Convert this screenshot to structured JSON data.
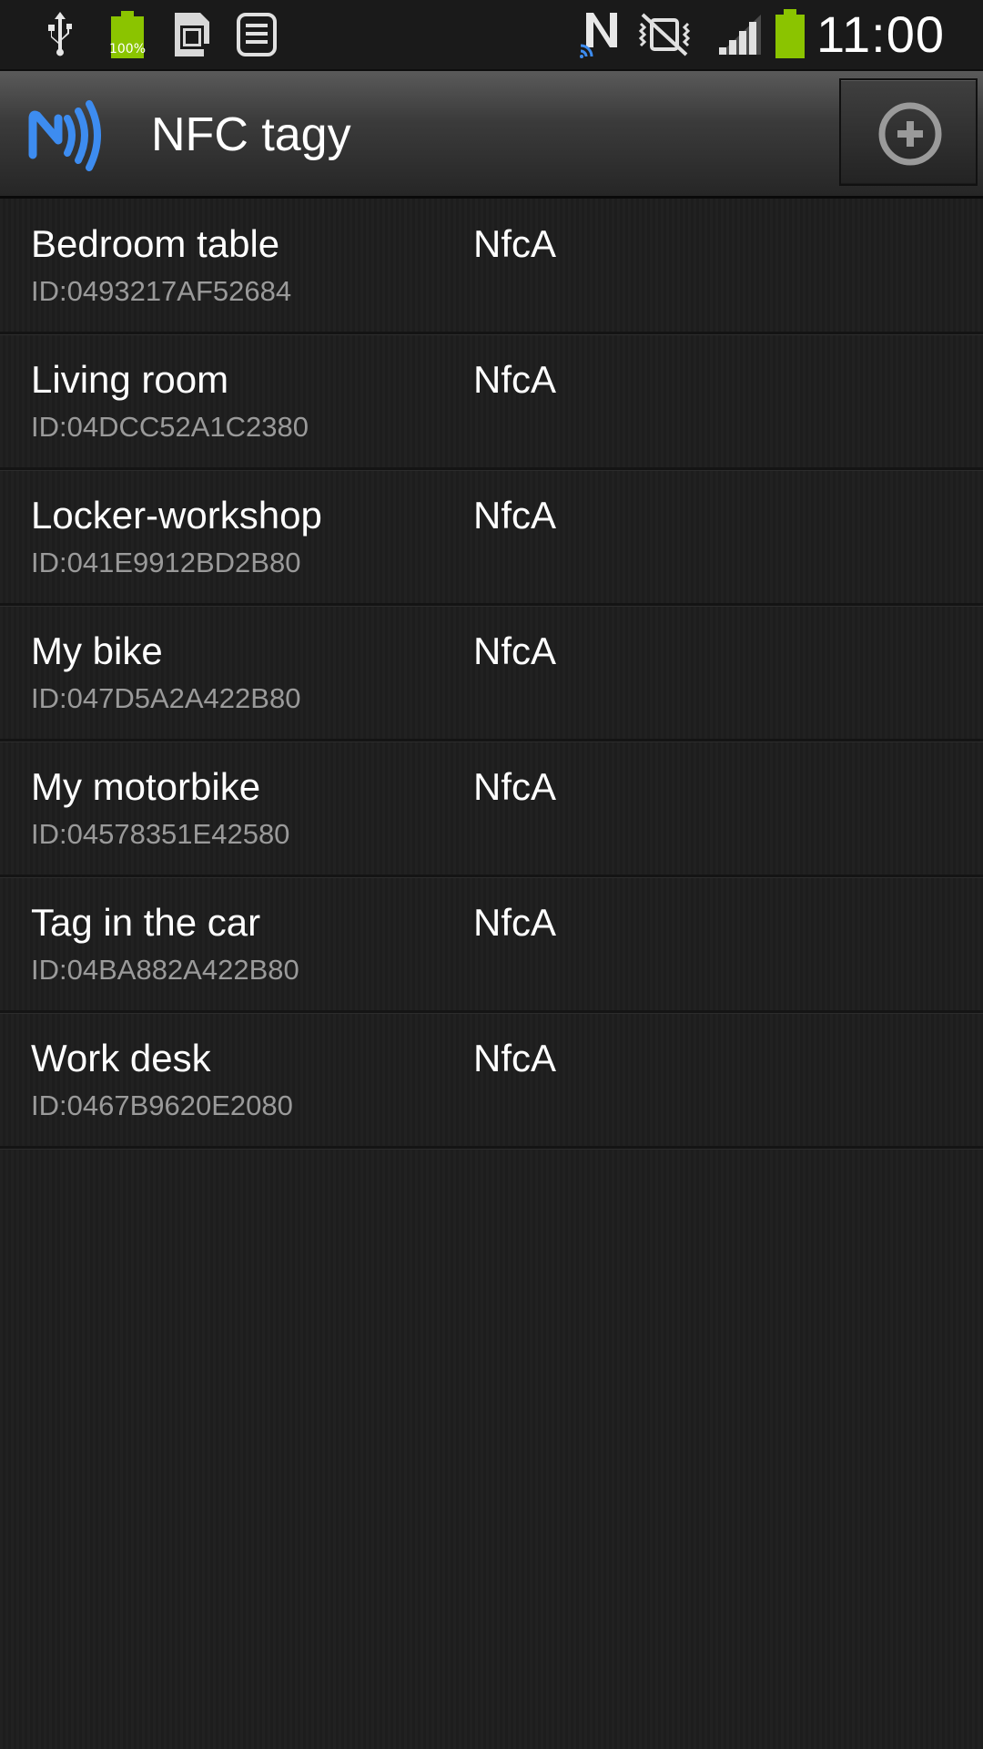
{
  "status_bar": {
    "time": "11:00",
    "battery_label": "100%",
    "icons": [
      "usb-icon",
      "battery-icon",
      "sd-card-icon",
      "notes-icon",
      "nfc-n-icon",
      "mute-icon",
      "signal-icon",
      "battery-status-icon"
    ],
    "battery_color": "#8bc400"
  },
  "action_bar": {
    "title": "NFC tagy",
    "app_icon": "nfc-icon",
    "add_icon": "add-circle-icon",
    "accent_color": "#3d8cf0"
  },
  "tags": [
    {
      "name": "Bedroom table",
      "id": "ID:0493217AF52684",
      "type": "NfcA"
    },
    {
      "name": "Living room",
      "id": "ID:04DCC52A1C2380",
      "type": "NfcA"
    },
    {
      "name": "Locker-workshop",
      "id": "ID:041E9912BD2B80",
      "type": "NfcA"
    },
    {
      "name": "My bike",
      "id": "ID:047D5A2A422B80",
      "type": "NfcA"
    },
    {
      "name": "My motorbike",
      "id": "ID:04578351E42580",
      "type": "NfcA"
    },
    {
      "name": "Tag in the car",
      "id": "ID:04BA882A422B80",
      "type": "NfcA"
    },
    {
      "name": "Work desk",
      "id": "ID:0467B9620E2080",
      "type": "NfcA"
    }
  ]
}
